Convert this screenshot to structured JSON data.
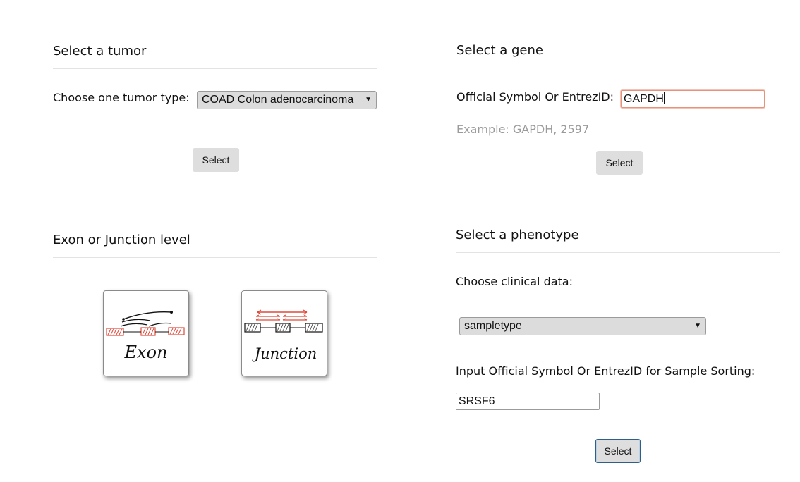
{
  "tumor": {
    "title": "Select a tumor",
    "choose_label": "Choose one tumor type:",
    "selected": "COAD Colon adenocarcinoma",
    "select_button": "Select"
  },
  "gene": {
    "title": "Select a gene",
    "label": "Official Symbol Or EntrezID:",
    "value": "GAPDH",
    "example": "Example: GAPDH, 2597",
    "select_button": "Select"
  },
  "level": {
    "title": "Exon or Junction level",
    "exon_label": "Exon",
    "junction_label": "Junction"
  },
  "phenotype": {
    "title": "Select a phenotype",
    "clinical_label": "Choose clinical data:",
    "clinical_selected": "sampletype",
    "sorting_label": "Input Official Symbol Or EntrezID for Sample Sorting:",
    "sorting_value": "SRSF6",
    "select_button": "Select"
  },
  "colors": {
    "accent_red": "#e04a3a",
    "button_bg": "#dedede",
    "focus_border": "#2c5f8a"
  }
}
